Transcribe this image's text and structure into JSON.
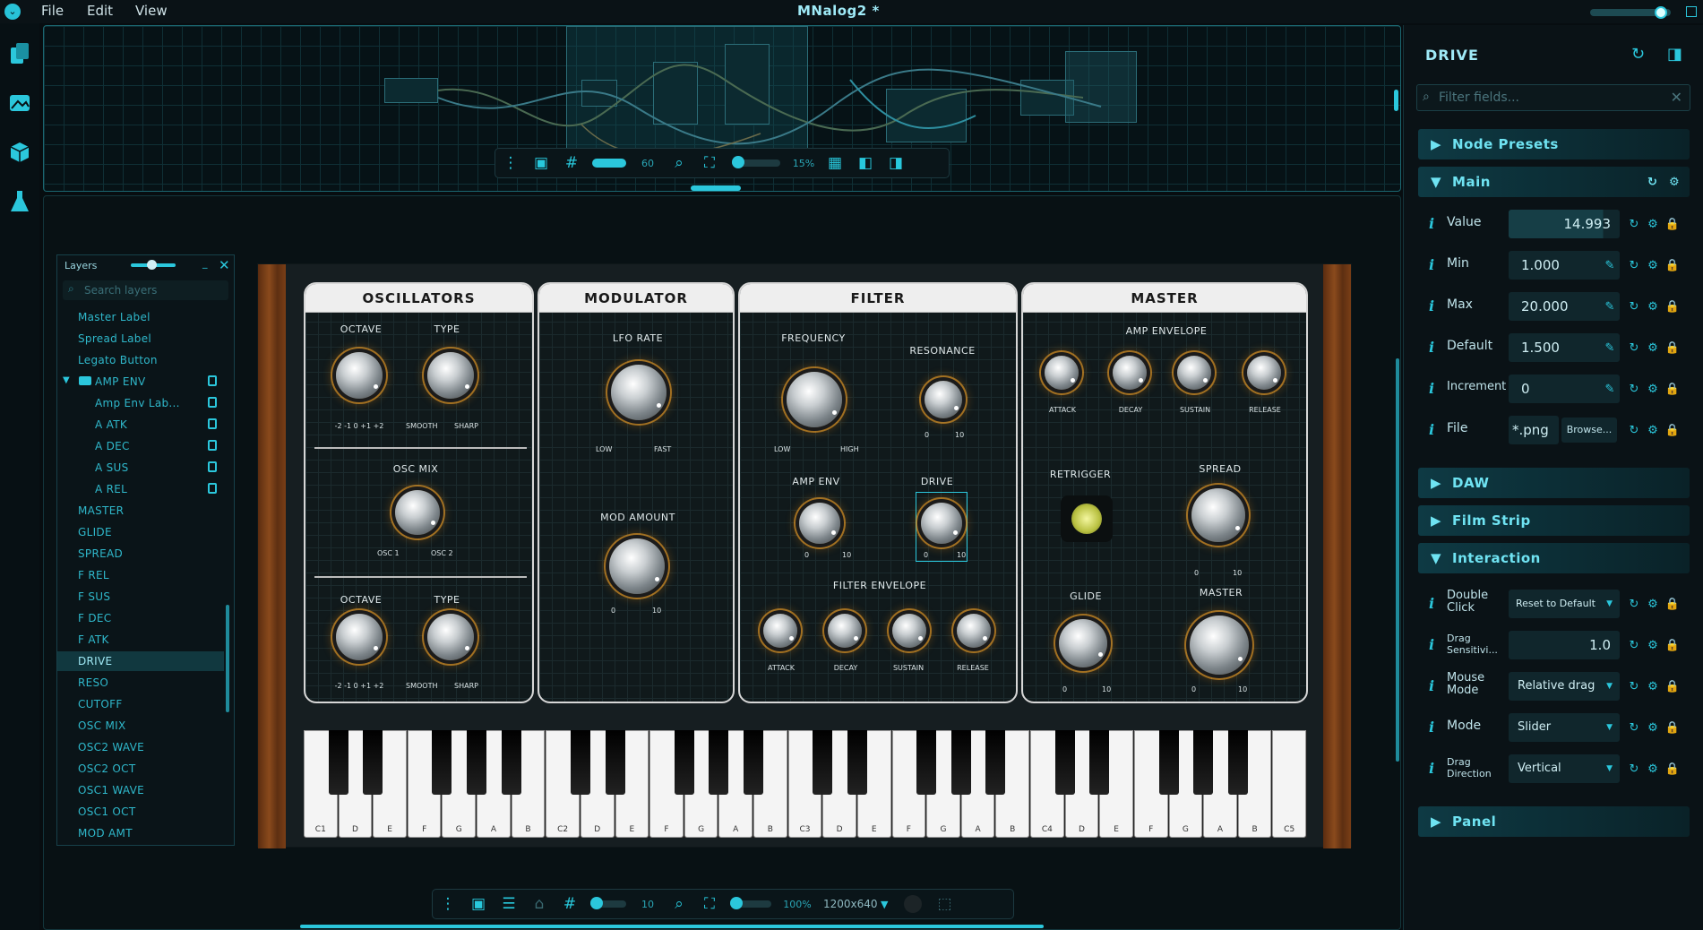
{
  "menu": {
    "file": "File",
    "edit": "Edit",
    "view": "View"
  },
  "app_title": "MNalog2  *",
  "mini_toolbar": {
    "snap_value": "60",
    "zoom_value": "15%"
  },
  "bottom_toolbar": {
    "snap_value": "10",
    "zoom_value": "100%",
    "resolution": "1200x640"
  },
  "layers": {
    "title": "Layers",
    "search_placeholder": "Search layers",
    "items": [
      "Master Label",
      "Spread Label",
      "Legato Button",
      "AMP ENV",
      "Amp Env Lab...",
      "A ATK",
      "A DEC",
      "A SUS",
      "A REL",
      "MASTER",
      "GLIDE",
      "SPREAD",
      "F REL",
      "F SUS",
      "F DEC",
      "F ATK",
      "DRIVE",
      "RESO",
      "CUTOFF",
      "OSC MIX",
      "OSC2 WAVE",
      "OSC2 OCT",
      "OSC1 WAVE",
      "OSC1 OCT",
      "MOD AMT"
    ],
    "selected": "DRIVE"
  },
  "synth": {
    "sections": {
      "osc": "OSCILLATORS",
      "mod": "MODULATOR",
      "filter": "FILTER",
      "master": "MASTER"
    },
    "labels": {
      "octave": "OCTAVE",
      "type": "TYPE",
      "osc_mix": "OSC MIX",
      "lfo_rate": "LFO RATE",
      "mod_amount": "MOD AMOUNT",
      "frequency": "FREQUENCY",
      "resonance": "RESONANCE",
      "amp_env": "AMP ENV",
      "drive": "DRIVE",
      "filter_env": "FILTER ENVELOPE",
      "amp_envelope": "AMP ENVELOPE",
      "retrigger": "RETRIGGER",
      "spread": "SPREAD",
      "glide": "GLIDE",
      "master": "MASTER"
    },
    "octave_ticks": "-2  -1  0  +1  +2",
    "smooth": "SMOOTH",
    "sharp": "SHARP",
    "osc1": "OSC 1",
    "osc2": "OSC 2",
    "low": "LOW",
    "fast": "FAST",
    "high": "HIGH",
    "zero": "0",
    "ten": "10",
    "env": {
      "attack": "ATTACK",
      "decay": "DECAY",
      "sustain": "SUSTAIN",
      "release": "RELEASE"
    },
    "white_keys": [
      "C1",
      "D",
      "E",
      "F",
      "G",
      "A",
      "B",
      "C2",
      "D",
      "E",
      "F",
      "G",
      "A",
      "B",
      "C3",
      "D",
      "E",
      "F",
      "G",
      "A",
      "B",
      "C4",
      "D",
      "E",
      "F",
      "G",
      "A",
      "B",
      "C5"
    ]
  },
  "panel": {
    "title": "DRIVE",
    "filter_placeholder": "Filter fields...",
    "sections": {
      "presets": "Node Presets",
      "main": "Main",
      "daw": "DAW",
      "film": "Film Strip",
      "interaction": "Interaction",
      "panel": "Panel"
    },
    "main": {
      "value_label": "Value",
      "value": "14.993",
      "min_label": "Min",
      "min": "1.000",
      "max_label": "Max",
      "max": "20.000",
      "default_label": "Default",
      "default": "1.500",
      "increment_label": "Increment",
      "increment": "0",
      "file_label": "File",
      "file": "*.png",
      "browse": "Browse..."
    },
    "interaction": {
      "double_click_label": "Double Click",
      "double_click": "Reset to Default",
      "drag_sens_label": "Drag Sensitivi...",
      "drag_sens": "1.0",
      "mouse_mode_label": "Mouse Mode",
      "mouse_mode": "Relative drag",
      "mode_label": "Mode",
      "mode": "Slider",
      "drag_dir_label": "Drag Direction",
      "drag_dir": "Vertical"
    }
  },
  "colors": {
    "accent": "#2bc7dc",
    "knob_glow": "#ffaa28"
  }
}
